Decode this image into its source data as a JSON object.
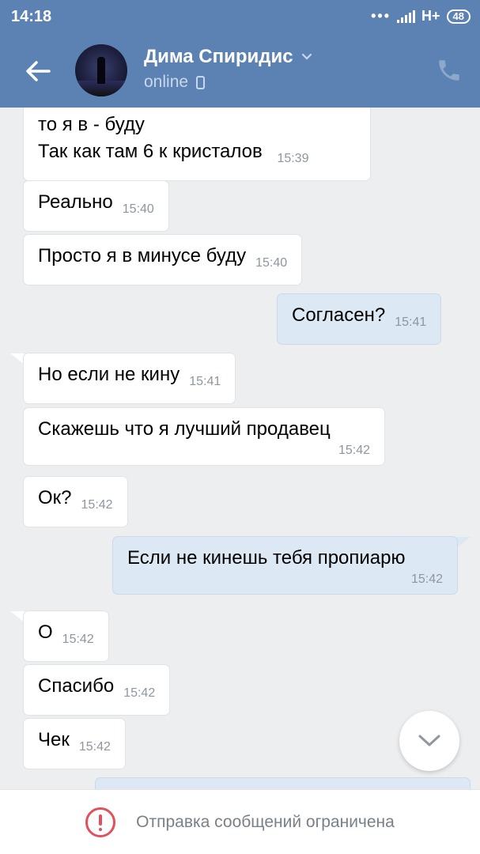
{
  "status_bar": {
    "time": "14:18",
    "network": "H+",
    "battery": "48"
  },
  "header": {
    "contact_name": "Дима Спиридис",
    "presence": "online"
  },
  "messages": [
    {
      "dir": "in",
      "lines": [
        "то я в - буду",
        "Так как там 6 к кристалов"
      ],
      "time": "15:39"
    },
    {
      "dir": "in",
      "text": "Реально",
      "time": "15:40"
    },
    {
      "dir": "in",
      "text": "Просто я в минусе буду",
      "time": "15:40"
    },
    {
      "dir": "out",
      "text": "Согласен?",
      "time": "15:41"
    },
    {
      "dir": "in",
      "text": "Но если не кину",
      "time": "15:41"
    },
    {
      "dir": "in",
      "text": "Скажешь что я лучший продавец",
      "time": "15:42"
    },
    {
      "dir": "in",
      "text": "Ок?",
      "time": "15:42"
    },
    {
      "dir": "out",
      "text": "Если не кинешь тебя пропиарю",
      "time": "15:42"
    },
    {
      "dir": "in",
      "text": "О",
      "time": "15:42"
    },
    {
      "dir": "in",
      "text": "Спасибо",
      "time": "15:42"
    },
    {
      "dir": "in",
      "text": "Чек",
      "time": "15:42"
    }
  ],
  "footer": {
    "notice": "Отправка сообщений ограничена"
  },
  "icons": [
    "back-arrow-icon",
    "chevron-down-icon",
    "mobile-phone-icon",
    "call-icon",
    "scroll-down-icon",
    "warning-icon"
  ],
  "colors": {
    "header": "#5b82b3",
    "background": "#edeef0",
    "outgoing_bubble": "#dde8f5",
    "warning": "#e0515b"
  }
}
